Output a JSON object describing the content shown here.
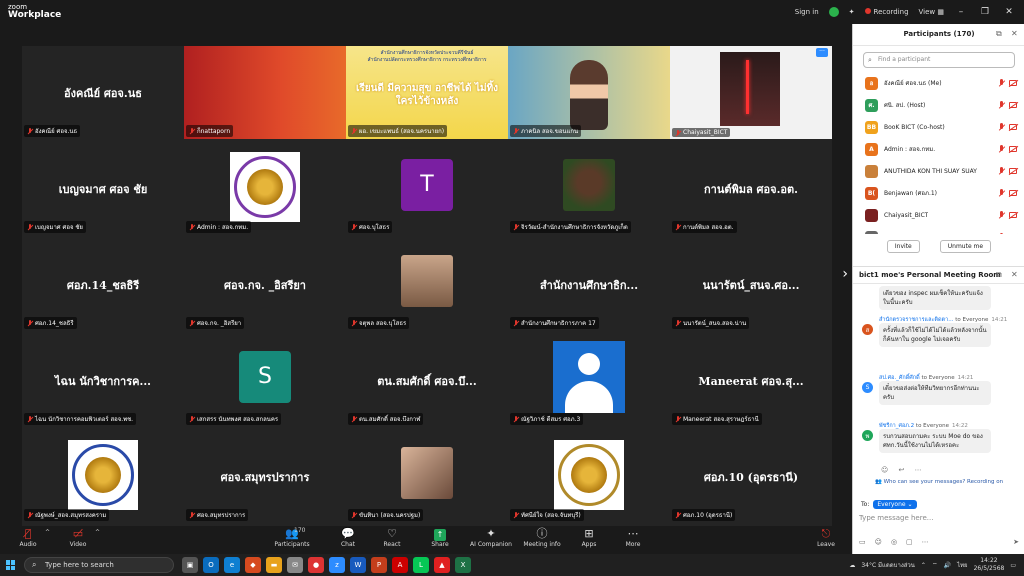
{
  "titlebar": {
    "logo_line1": "zoom",
    "logo_line2": "Workplace",
    "sign_in": "Sign in",
    "recording": "Recording",
    "view": "View"
  },
  "tiles": [
    {
      "big": "อังคณีย์ ศอจ.นธ",
      "cap": "อังคณีย์ ศอจ.นธ"
    },
    {
      "big": "",
      "cap": "ก็nattaporn"
    },
    {
      "big": "เรียนดี มีความสุข อาชีพได้ ไม่ทิ้งใครไว้ข้างหลัง",
      "cap": "ผอ. เขมะแพนธ์ (สอจ.นครนายก)"
    },
    {
      "big": "",
      "cap": "ภาคนิล สอจ.ขอนแกน"
    },
    {
      "big": "",
      "cap": "Chaiyasit_BICT"
    },
    {
      "big": "เบญจมาศ ศอจ ชัย",
      "cap": "เบญจมาศ ศอจ ชัย"
    },
    {
      "big": "",
      "cap": "Admin : สอจ.กทม."
    },
    {
      "big": "",
      "avatar": "T",
      "cap": "ศอจ.บุโสธร"
    },
    {
      "big": "",
      "cap": "จิรวัฒน์-สำนักงานศึกษาธิการจังหวัดภูเก็ต"
    },
    {
      "big": "กานต์พิมล ศอจ.อต.",
      "cap": "กานต์พิมล สอจ.อต."
    },
    {
      "big": "ศอภ.14_ชลธิรี",
      "cap": "ศอภ.14_ชลธิรี"
    },
    {
      "big": "ศอจ.กจ. _อิสรียา",
      "cap": "ศอจ.กจ. _อิสรียา"
    },
    {
      "big": "",
      "cap": "จตุพล สอจ.บุโสธร"
    },
    {
      "big": "สำนักงานศึกษาธิก...",
      "cap": "สำนักงานศึกษาธิการภาค 17"
    },
    {
      "big": "นนารัตน์_สนจ.ศอ...",
      "cap": "นนารัตน์_สนจ.สอจ.น่าน"
    },
    {
      "big": "ไฉน นักวิชาการค...",
      "cap": "ไฉน นักวิชาการคอมพิวเตอร์ สอจ.พช."
    },
    {
      "big": "",
      "avatar": "S",
      "cap": "เสกสรร นันทพงศ สอจ.สกลนคร"
    },
    {
      "big": "ตน.สมศักดิ์ ศอจ.บึ...",
      "cap": "ตน.สมศักดิ์ สอจ.บึงกาฬ"
    },
    {
      "big": "",
      "cap": "ณัฐวิภาช์ ดีสมร ศอภ.3"
    },
    {
      "big": "Maneerat ศอจ.สุ...",
      "cap": "Maneerat สอจ.สุราษฎร์ธานี"
    },
    {
      "big": "",
      "cap": "ณัฐพงษ์_สอจ.สมุทรสงคราม"
    },
    {
      "big": "ศอจ.สมุทรปราการ",
      "cap": "ศอจ.สมุทรปราการ"
    },
    {
      "big": "",
      "cap": "ขันทินา (สอจ.นครปฐม)"
    },
    {
      "big": "",
      "cap": "ทัศนีย์ใจ (สอจ.จันทบุรี)"
    },
    {
      "big": "ศอภ.10 (อุดรธานี)",
      "cap": "ศอภ.10 (อุดรธานี)"
    }
  ],
  "banner": {
    "line1": "สำนักงานศึกษาธิการจังหวัดประจวบคีรีขันธ์",
    "line2": "สำนักงานปลัดกระทรวงศึกษาธิการ กระทรวงศึกษาธิการ"
  },
  "toolbar": {
    "audio": "Audio",
    "video": "Video",
    "participants": "Participants",
    "participants_count": "170",
    "chat": "Chat",
    "react": "React",
    "share": "Share",
    "ai_companion": "AI Companion",
    "meeting_info": "Meeting info",
    "apps": "Apps",
    "more": "More",
    "leave": "Leave"
  },
  "participants_panel": {
    "title": "Participants (170)",
    "search_placeholder": "Find a participant",
    "invite": "Invite",
    "unmute_me": "Unmute me",
    "rows": [
      {
        "initial": "อ",
        "color": "#e8731c",
        "name": "อังคณีย์ ศอจ.นธ (Me)"
      },
      {
        "initial": "ศ.",
        "color": "#2e9e5b",
        "name": "ศนิ. สป. (Host)"
      },
      {
        "initial": "BB",
        "color": "#f0a21c",
        "name": "BooK BICT (Co-host)"
      },
      {
        "initial": "A",
        "color": "#e8731c",
        "name": "Admin : สอจ.กทม."
      },
      {
        "initial": "",
        "color": "#c9803a",
        "name": "ANUTHIDA KON THI SUAY SUAY"
      },
      {
        "initial": "B(",
        "color": "#d9541e",
        "name": "Benjawan (ศอภ.1)"
      },
      {
        "initial": "",
        "color": "#7a2020",
        "name": "Chaiyasit_BICT"
      },
      {
        "initial": "",
        "color": "#666666",
        "name": "Chaiyasit BICT"
      }
    ]
  },
  "chat_panel": {
    "title": "bict1 moe's Personal Meeting Room",
    "messages": [
      {
        "sender": "",
        "to": "",
        "time": "",
        "initial": "",
        "color": "#ffffff",
        "text": "เดียวของ inspec ผมเช็คให้นะครับแจ้งในนี้นะครับ"
      },
      {
        "sender": "สำนักตรวจราชการและติดตา...",
        "to": "to Everyone",
        "time": "14:21",
        "initial": "ส",
        "color": "#d9541e",
        "text": "ครั้งที่แล้วก็ใช้ไม่ได้ไม่ได้แล้วหลังจากนั้นก็ค้นหาใน google ไม่เจอครับ"
      },
      {
        "sender": "สป.ศอ._ศักดิ์ศักดิ์",
        "to": "to Everyone",
        "time": "14:21",
        "initial": "S",
        "color": "#2d8cff",
        "text": "เดี๋ยวขอส่งต่อให้ทีมวิทยากรอีกท่านนะครับ"
      },
      {
        "sender": "พัชรีกา_ศอภ.2",
        "to": "to Everyone",
        "time": "14:22",
        "initial": "พ",
        "color": "#1fa65a",
        "text": "รบกวนสอบถามคะ ระบบ Moe do ของ ศทก.วันนี้ใช้งานไม่ได้เหรอคะ"
      }
    ],
    "notice": "Who can see your messages? Recording on",
    "to_label": "To:",
    "to_value": "Everyone",
    "placeholder": "Type message here..."
  },
  "taskbar": {
    "search_placeholder": "Type here to search",
    "weather": "34°C  มีแดดบางส่วน",
    "lang": "ไทย",
    "time": "14:22",
    "date": "26/5/2568"
  }
}
